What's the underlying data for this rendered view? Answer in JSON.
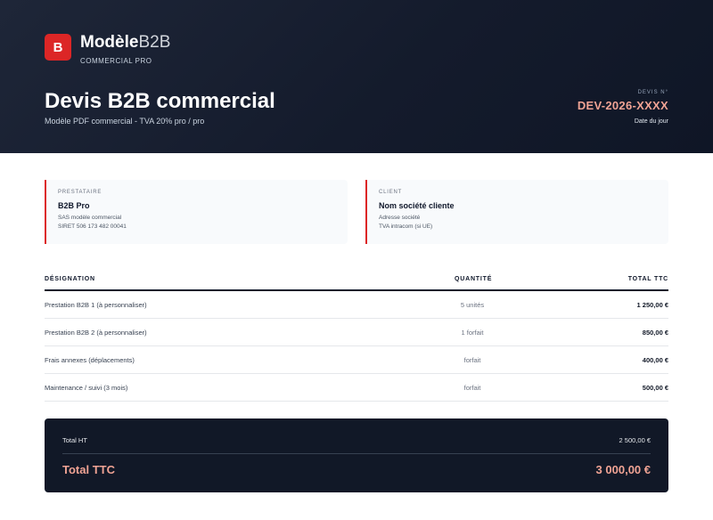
{
  "brand": {
    "logo_letter": "B",
    "name_bold": "Modèle",
    "name_light": "B2B",
    "tagline": "COMMERCIAL PRO"
  },
  "document": {
    "title": "Devis B2B commercial",
    "subtitle": "Modèle PDF commercial - TVA 20% pro / pro",
    "number_label": "DEVIS N°",
    "number": "DEV-2026-XXXX",
    "date": "Date du jour"
  },
  "provider": {
    "label": "PRESTATAIRE",
    "name": "B2B Pro",
    "line1": "SAS modèle commercial",
    "line2": "SIRET 506 173 482 00041"
  },
  "client": {
    "label": "CLIENT",
    "name": "Nom société cliente",
    "line1": "Adresse société",
    "line2": "TVA intracom (si UE)"
  },
  "table": {
    "headers": [
      "DÉSIGNATION",
      "QUANTITÉ",
      "TOTAL TTC"
    ],
    "rows": [
      {
        "designation": "Prestation B2B 1 (à personnaliser)",
        "quantity": "5 unités",
        "total": "1 250,00 €"
      },
      {
        "designation": "Prestation B2B 2 (à personnaliser)",
        "quantity": "1 forfait",
        "total": "850,00 €"
      },
      {
        "designation": "Frais annexes (déplacements)",
        "quantity": "forfait",
        "total": "400,00 €"
      },
      {
        "designation": "Maintenance / suivi (3 mois)",
        "quantity": "forfait",
        "total": "500,00 €"
      }
    ]
  },
  "totals": {
    "ht_label": "Total HT",
    "ht_value": "2 500,00 €",
    "ttc_label": "Total TTC",
    "ttc_value": "3 000,00 €"
  },
  "colors": {
    "accent": "#dc2626",
    "highlight": "#f0a394",
    "dark": "#111827"
  }
}
